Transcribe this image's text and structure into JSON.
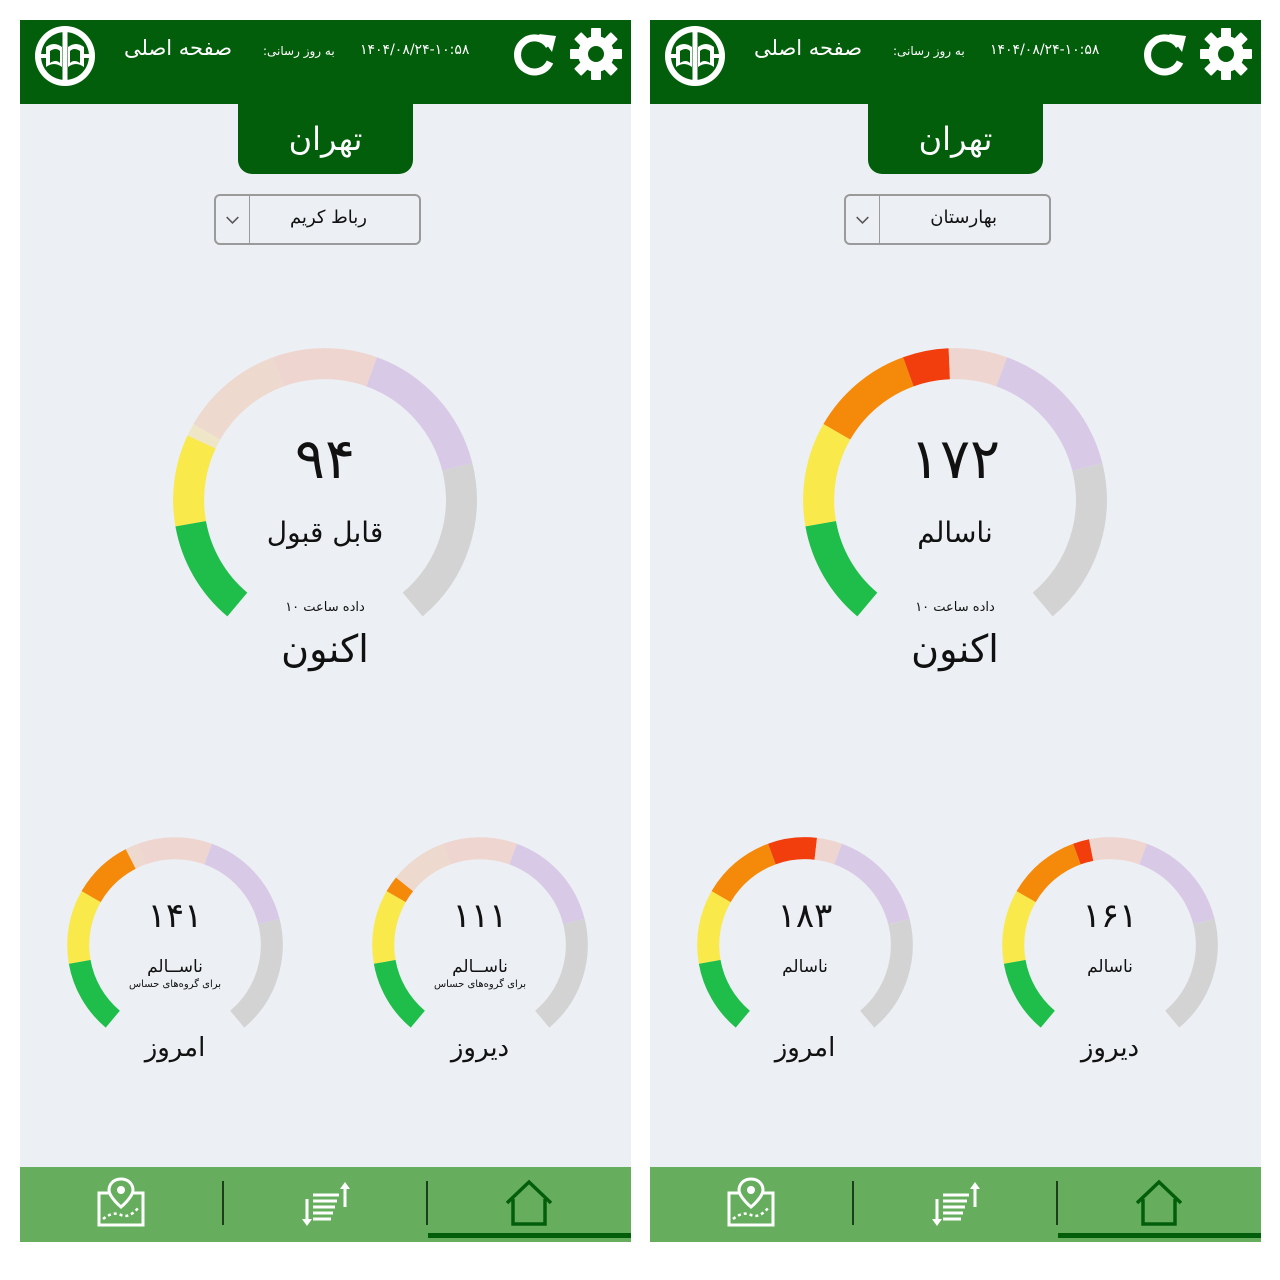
{
  "colors": {
    "header_bg": "#035e0b",
    "nav_bg": "#66ae5e",
    "page_bg": "#eceff3",
    "aqi_good": "#1fbe4a",
    "aqi_moderate": "#f9e94a",
    "aqi_sensitive": "#f58a0a",
    "aqi_unhealthy": "#f23d0c",
    "aqi_very_unhealthy": "#a47cc6",
    "aqi_hazardous": "#c9c9c9"
  },
  "icons": {
    "logo": "environment-org-logo",
    "refresh": "refresh-icon",
    "settings": "gear-icon",
    "station_dropdown": "chevron-down-icon",
    "nav_map": "map-pin-icon",
    "nav_list": "sort-list-icon",
    "nav_home": "home-icon"
  },
  "screens": [
    {
      "header": {
        "title": "صفحه اصلی",
        "updated_label": "به روز رسانی:",
        "updated_time": "۱۴۰۴/۰۸/۲۴-۱۰:۵۸"
      },
      "city": "تهران",
      "station": "رباط کریم",
      "now": {
        "value": 94,
        "value_text": "۹۴",
        "status": "قابل قبول",
        "hours_note": "داده ساعت ۱۰",
        "caption": "اکنون"
      },
      "today": {
        "value": 141,
        "value_text": "۱۴۱",
        "status": "ناســالم",
        "sub": "برای گروه‌های حساس",
        "caption": "امروز"
      },
      "yesterday": {
        "value": 111,
        "value_text": "۱۱۱",
        "status": "ناســالم",
        "sub": "برای گروه‌های حساس",
        "caption": "دیروز"
      }
    },
    {
      "header": {
        "title": "صفحه اصلی",
        "updated_label": "به روز رسانی:",
        "updated_time": "۱۴۰۴/۰۸/۲۴-۱۰:۵۸"
      },
      "city": "تهران",
      "station": "بهارستان",
      "now": {
        "value": 172,
        "value_text": "۱۷۲",
        "status": "ناسالم",
        "hours_note": "داده ساعت ۱۰",
        "caption": "اکنون"
      },
      "today": {
        "value": 183,
        "value_text": "۱۸۳",
        "status": "ناسالم",
        "sub": "",
        "caption": "امروز"
      },
      "yesterday": {
        "value": 161,
        "value_text": "۱۶۱",
        "status": "ناسالم",
        "sub": "",
        "caption": "دیروز"
      }
    }
  ]
}
